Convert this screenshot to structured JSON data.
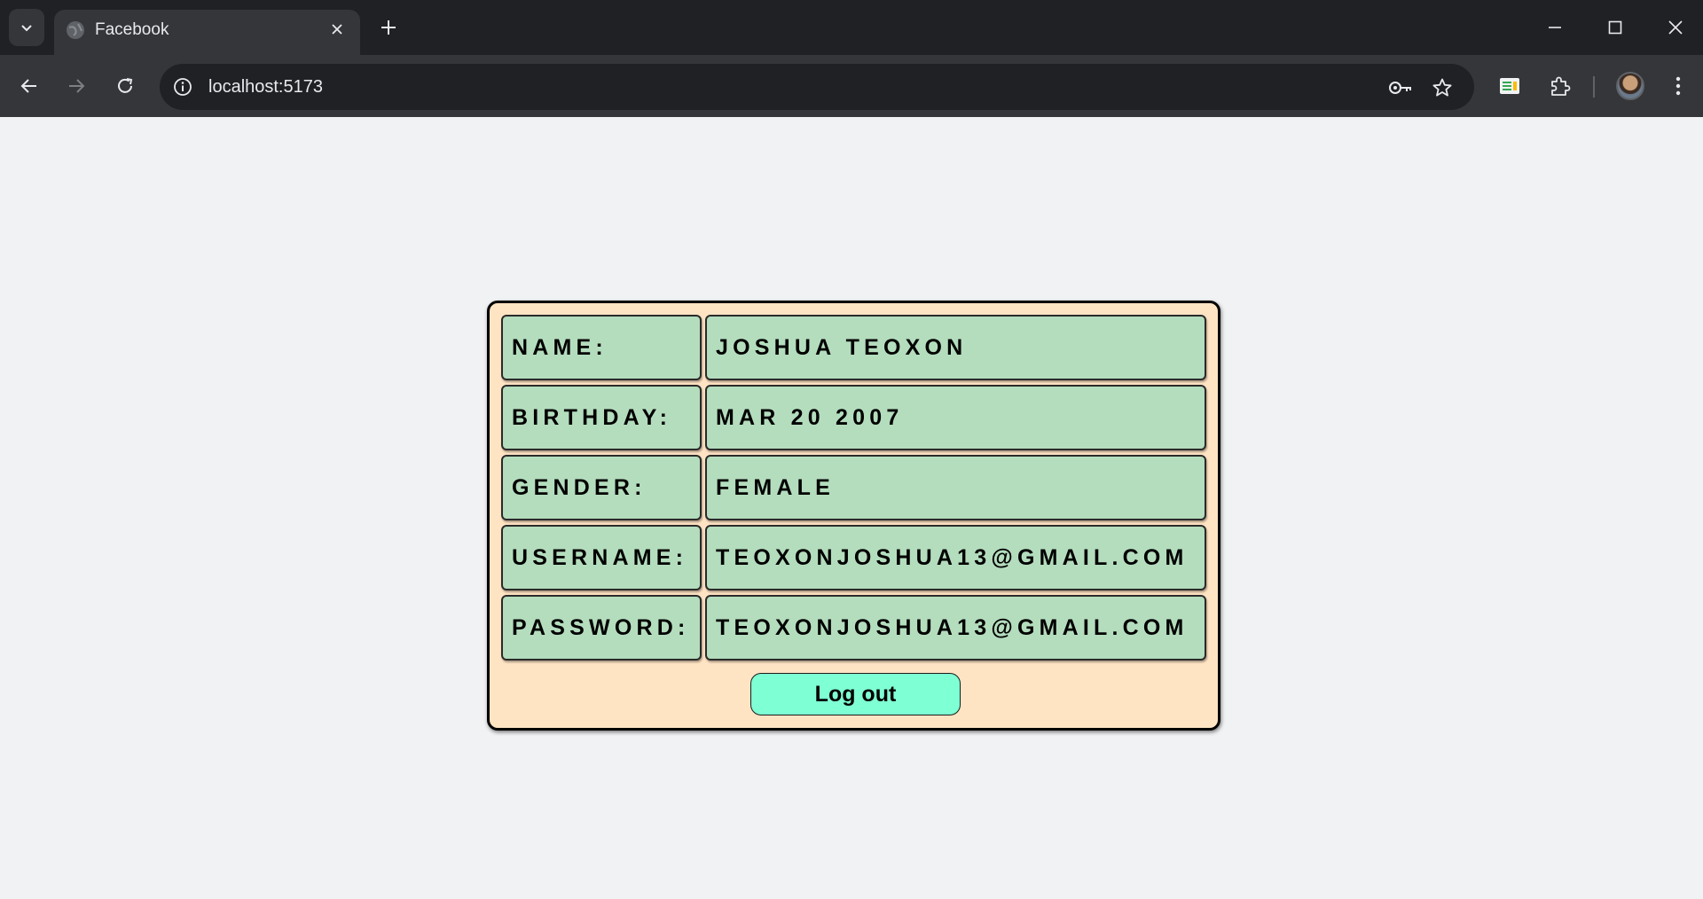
{
  "browser": {
    "tab_title": "Facebook",
    "url": "localhost:5173",
    "icons": [
      "tab-search-icon",
      "globe-icon",
      "close-icon",
      "plus-icon",
      "minimize-icon",
      "maximize-icon",
      "close-window-icon",
      "back-arrow-icon",
      "forward-arrow-icon",
      "reload-icon",
      "info-icon",
      "key-icon",
      "star-icon",
      "sheets-extension-icon",
      "puzzle-icon",
      "avatar",
      "kebab-menu-icon"
    ]
  },
  "profile": {
    "rows": [
      {
        "label": "NAME:",
        "value": "JOSHUA TEOXON"
      },
      {
        "label": "BIRTHDAY:",
        "value": "MAR 20 2007"
      },
      {
        "label": "GENDER:",
        "value": "FEMALE"
      },
      {
        "label": "USERNAME:",
        "value": "TEOXONJOSHUA13@GMAIL.COM"
      },
      {
        "label": "PASSWORD:",
        "value": "TEOXONJOSHUA13@GMAIL.COM"
      }
    ],
    "logout_label": "Log out"
  },
  "colors": {
    "card_bg": "#ffe4c4",
    "cell_bg": "#b4ddbd",
    "button_bg": "#7fffd4",
    "page_bg": "#f1f2f4"
  }
}
